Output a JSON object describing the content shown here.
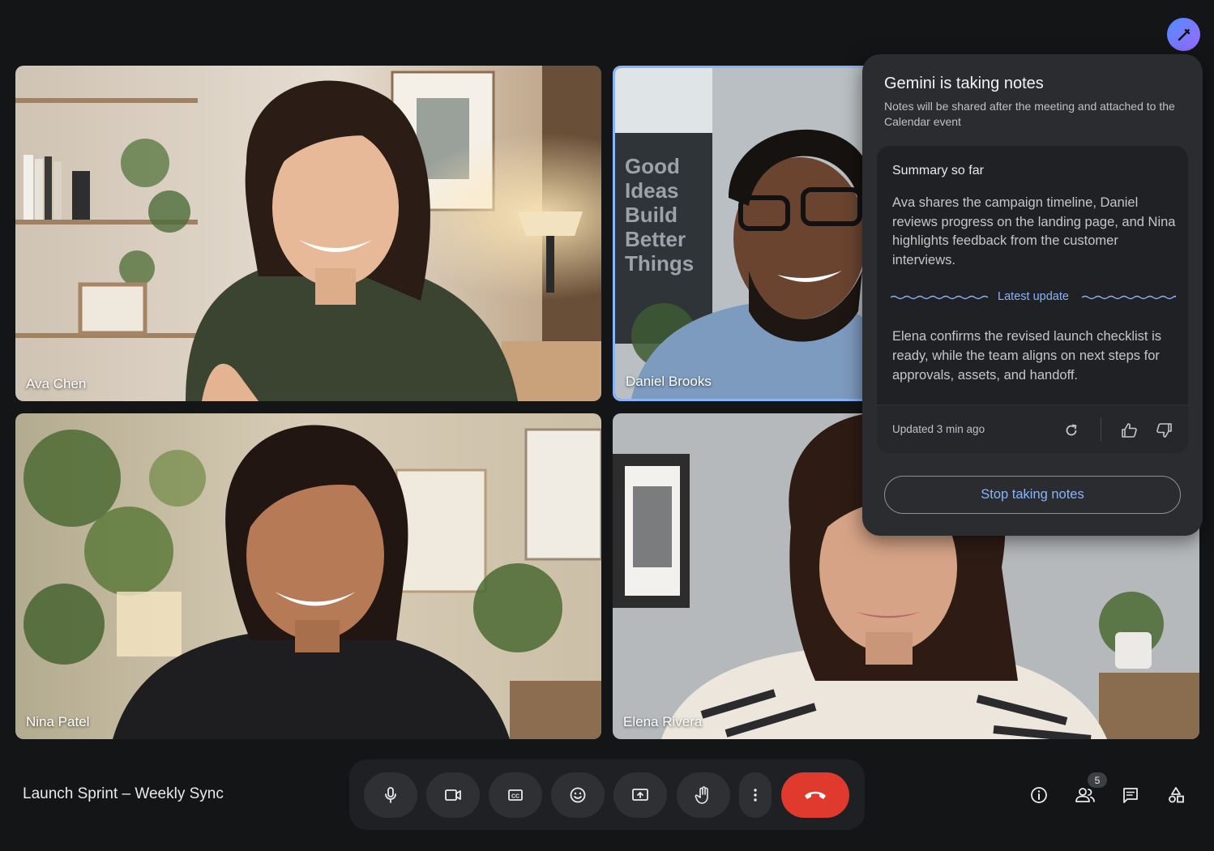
{
  "participants": [
    {
      "name": "Ava Chen"
    },
    {
      "name": "Daniel Brooks"
    },
    {
      "name": "Nina Patel"
    },
    {
      "name": "Elena Rivera"
    }
  ],
  "poster_text": "Good Ideas Build Better Things",
  "gemini_panel": {
    "title": "Gemini is taking notes",
    "subtitle": "Notes will be shared after the meeting and attached to the Calendar event",
    "summary_heading": "Summary so far",
    "summary_text": "Ava shares the campaign timeline, Daniel reviews progress on the landing page, and Nina highlights feedback from the customer interviews.",
    "latest_label": "Latest update",
    "latest_text": "Elena confirms the revised launch checklist is ready, while the team aligns on next steps for approvals, assets, and handoff.",
    "updated": "Updated 3 min ago",
    "stop_button": "Stop taking notes"
  },
  "meeting": {
    "title": "Launch Sprint – Weekly Sync"
  },
  "controls": [
    {
      "icon": "microphone-icon"
    },
    {
      "icon": "camera-icon"
    },
    {
      "icon": "captions-icon"
    },
    {
      "icon": "emoji-icon"
    },
    {
      "icon": "present-screen-icon"
    },
    {
      "icon": "raise-hand-icon"
    },
    {
      "icon": "more-options-icon"
    },
    {
      "icon": "end-call-icon"
    }
  ],
  "right_icons": {
    "people_count": "5"
  },
  "colors": {
    "accent": "#8ab4f8",
    "end_call": "#e0392e",
    "panel_bg": "#2b2c2f",
    "page_bg": "#141517"
  }
}
